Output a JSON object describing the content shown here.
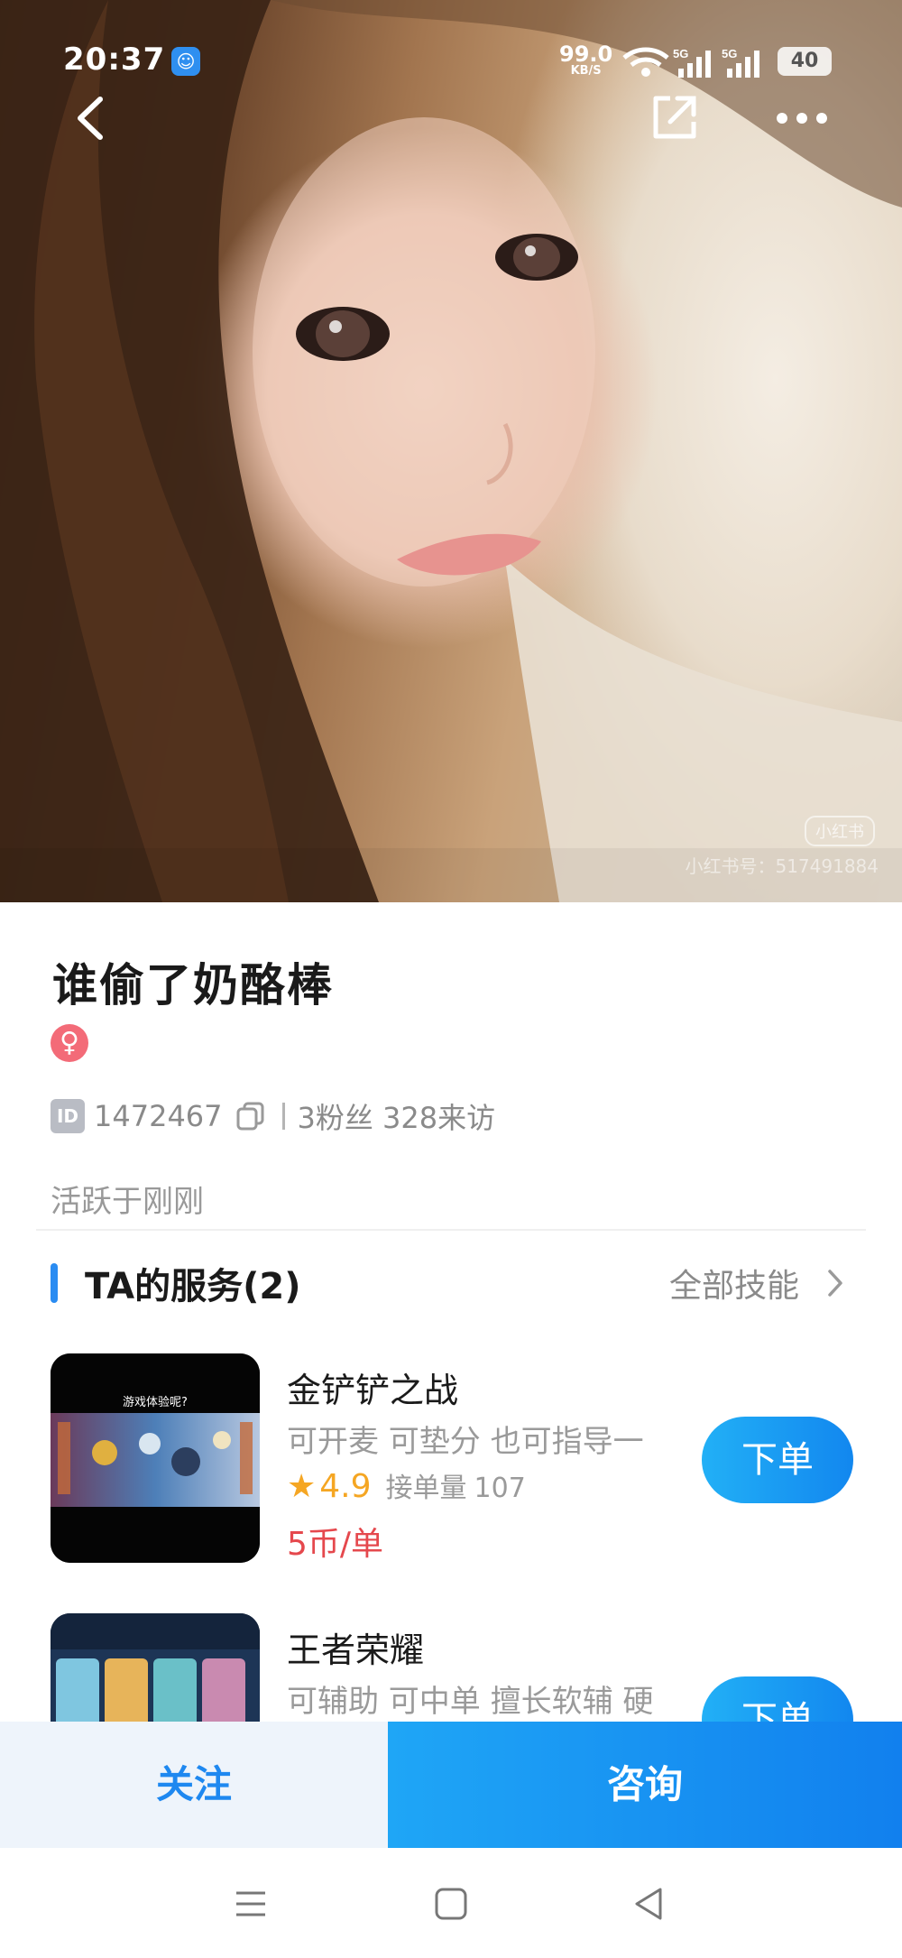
{
  "status_bar": {
    "time": "20:37",
    "app_icon": "baby-face-app-icon",
    "net_speed_value": "99.0",
    "net_speed_unit": "KB/S",
    "network_labels": [
      "5G",
      "5G"
    ],
    "battery": "40"
  },
  "hero": {
    "watermark_logo": "小红书",
    "watermark_text": "小红书号：517491884"
  },
  "profile": {
    "name": "谁偷了奶酪棒",
    "gender_symbol": "♀",
    "id_badge": "ID",
    "id": "1472467",
    "stats": "3粉丝 328来访",
    "active_status": "活跃于刚刚"
  },
  "services_section": {
    "title": "TA的服务(2)",
    "all_link": "全部技能",
    "items": [
      {
        "name": "金铲铲之战",
        "desc": "可开麦 可垫分 也可指导一",
        "rating": "4.9",
        "orders_label": "接单量",
        "orders": "107",
        "price": "5币/单",
        "button": "下单",
        "thumb_caption": "游戏体验呢?"
      },
      {
        "name": "王者荣耀",
        "desc": "可辅助 可中单 擅长软辅 硬",
        "button": "下单"
      }
    ]
  },
  "actions": {
    "follow": "关注",
    "consult": "咨询"
  },
  "colors": {
    "accent": "#1e88f0",
    "price": "#e5484d",
    "rating": "#f5a623",
    "gender": "#f36b78"
  },
  "icons": [
    "back-icon",
    "share-icon",
    "more-icon",
    "copy-icon",
    "chevron-right-icon",
    "star-icon",
    "menu-icon",
    "home-icon",
    "back-triangle-icon"
  ]
}
